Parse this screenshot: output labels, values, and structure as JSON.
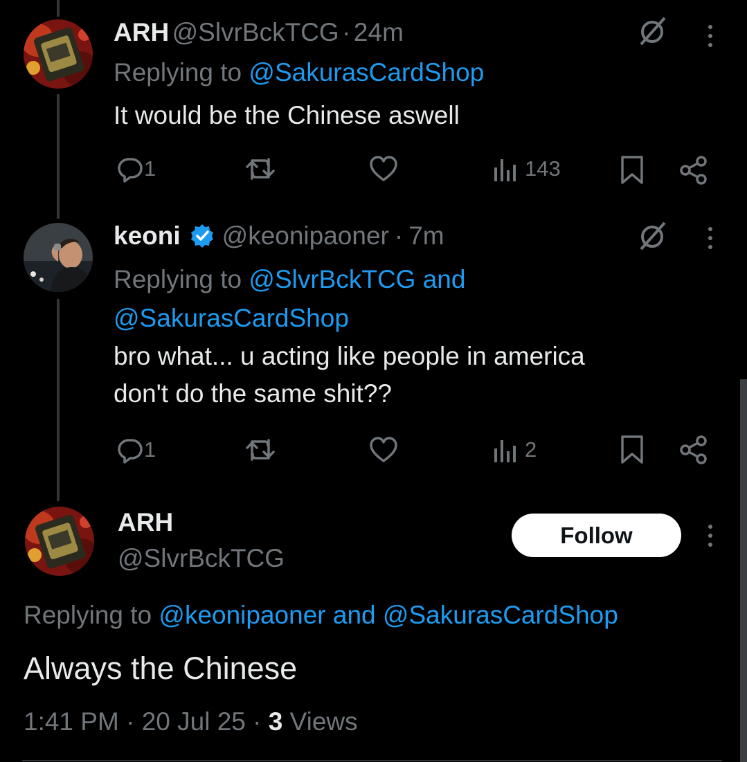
{
  "tweets": [
    {
      "name": "ARH",
      "handle": "@SlvrBckTCG",
      "sep": "·",
      "time": "24m",
      "replying_prefix": "Replying to",
      "replying_to": "@SakurasCardShop",
      "text": "It would be the Chinese aswell",
      "reply_count": "1",
      "views": "143"
    },
    {
      "name": "keoni",
      "verified": true,
      "handle": "@keonipaoner",
      "sep": "·",
      "time": "7m",
      "replying_prefix": "Replying to",
      "replying_to_line1": "@SlvrBckTCG and",
      "replying_to_line2": "@SakurasCardShop",
      "text_line1": "bro what... u acting like people in america",
      "text_line2": "don't do the same shit??",
      "reply_count": "1",
      "views": "2"
    }
  ],
  "main_tweet": {
    "name": "ARH",
    "handle": "@SlvrBckTCG",
    "follow_label": "Follow",
    "replying_prefix": "Replying to",
    "replying_to": "@keonipaoner and @SakurasCardShop",
    "text": "Always the Chinese",
    "time": "1:41 PM",
    "sep": "·",
    "date": "20 Jul 25",
    "views_count": "3",
    "views_label": "Views"
  },
  "colors": {
    "background": "#000000",
    "text": "#e7e9ea",
    "muted": "#71767b",
    "link": "#1d9bf0",
    "follow_bg": "#ffffff"
  },
  "icons": [
    "grok-icon",
    "more-icon",
    "reply-icon",
    "repost-icon",
    "like-icon",
    "views-icon",
    "bookmark-icon",
    "share-icon",
    "verified-badge-icon"
  ]
}
